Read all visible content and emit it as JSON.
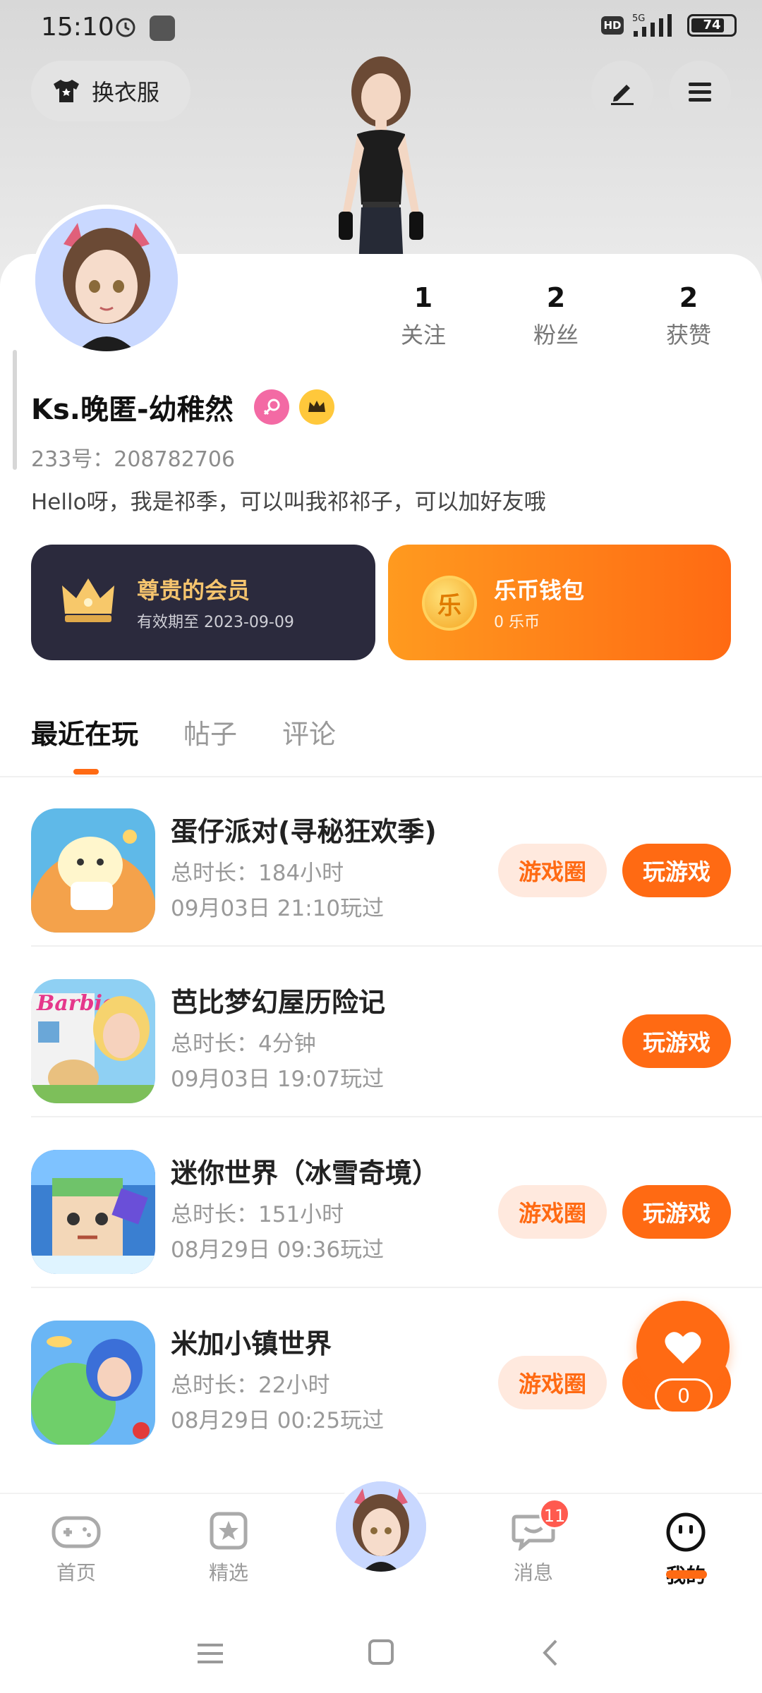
{
  "status_bar": {
    "time": "15:10",
    "hd": "HD",
    "network": "5G",
    "battery": "74"
  },
  "header": {
    "dress_button_label": "换衣服"
  },
  "stats": [
    {
      "value": "1",
      "label": "关注"
    },
    {
      "value": "2",
      "label": "粉丝"
    },
    {
      "value": "2",
      "label": "获赞"
    }
  ],
  "profile": {
    "nickname": "Ks.晚匿-幼稚然",
    "uid": "233号：208782706",
    "bio": "Hello呀，我是祁季，可以叫我祁祁子，可以加好友哦"
  },
  "vip": {
    "title": "尊贵的会员",
    "subtitle": "有效期至 2023-09-09"
  },
  "wallet": {
    "title": "乐币钱包",
    "subtitle": "0 乐币",
    "coin_glyph": "乐"
  },
  "tabs": [
    {
      "label": "最近在玩",
      "active": true
    },
    {
      "label": "帖子",
      "active": false
    },
    {
      "label": "评论",
      "active": false
    }
  ],
  "games": [
    {
      "name": "蛋仔派对(寻秘狂欢季)",
      "duration": "总时长：184小时",
      "last_played": "09月03日 21:10玩过",
      "circle_btn": "游戏圈",
      "play_btn": "玩游戏"
    },
    {
      "name": "芭比梦幻屋历险记",
      "duration": "总时长：4分钟",
      "last_played": "09月03日 19:07玩过",
      "circle_btn": "",
      "play_btn": "玩游戏"
    },
    {
      "name": "迷你世界（冰雪奇境）",
      "duration": "总时长：151小时",
      "last_played": "08月29日 09:36玩过",
      "circle_btn": "游戏圈",
      "play_btn": "玩游戏"
    },
    {
      "name": "米加小镇世界",
      "duration": "总时长：22小时",
      "last_played": "08月29日 00:25玩过",
      "circle_btn": "游戏圈",
      "play_btn": "玩"
    }
  ],
  "float": {
    "like_count": "0"
  },
  "bottom_nav": [
    {
      "label": "首页",
      "icon": "gamepad-icon"
    },
    {
      "label": "精选",
      "icon": "star-card-icon"
    },
    {
      "label": "消息",
      "icon": "message-icon",
      "badge": "11"
    },
    {
      "label": "我的",
      "icon": "smiley-icon",
      "active": true
    }
  ],
  "colors": {
    "accent": "#ff6a13",
    "vip_bg": "#2b2a3d",
    "vip_gold": "#f5c46e",
    "badge_red": "#ff5a4f"
  }
}
